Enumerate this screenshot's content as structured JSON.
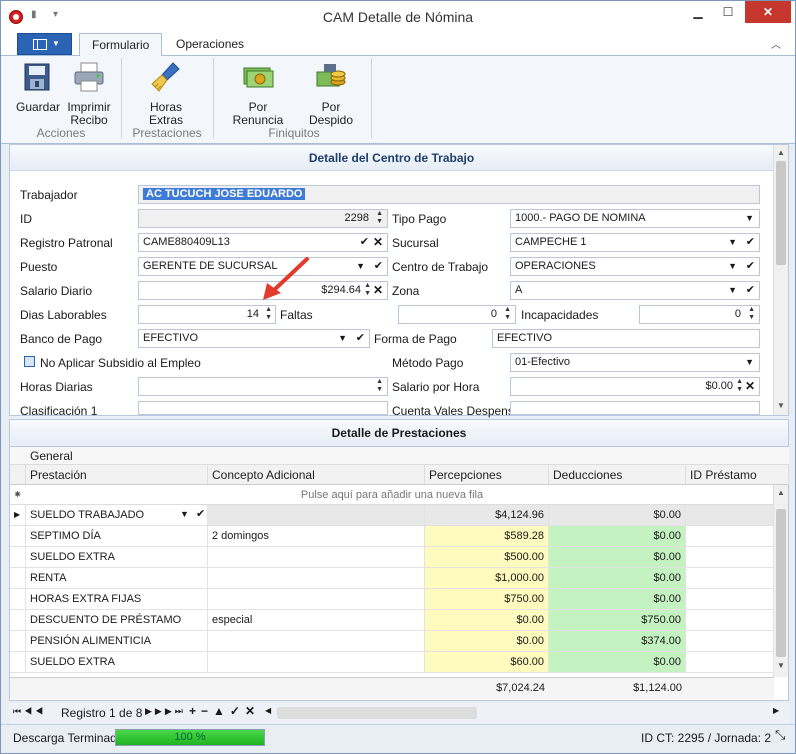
{
  "window": {
    "title": "CAM Detalle de Nómina",
    "minimize": "▁",
    "maximize": "☐",
    "close": "✕"
  },
  "tabs": [
    {
      "label": "Formulario"
    },
    {
      "label": "Operaciones"
    }
  ],
  "ribbon": {
    "buttons": [
      {
        "label": "Guardar"
      },
      {
        "label": "Imprimir\nRecibo"
      },
      {
        "label": "Horas\nExtras"
      },
      {
        "label": "Por Renuncia"
      },
      {
        "label": "Por Despido"
      }
    ],
    "groups": [
      "Acciones",
      "Prestaciones",
      "Finiquitos"
    ]
  },
  "form": {
    "title": "Detalle del Centro de Trabajo",
    "labels": {
      "trabajador": "Trabajador",
      "id": "ID",
      "registro": "Registro Patronal",
      "puesto": "Puesto",
      "salario": "Salario Diario",
      "dias": "Dias Laborables",
      "banco": "Banco de Pago",
      "subsidio": "No Aplicar Subsidio al Empleo",
      "horas": "Horas Diarias",
      "clasif": "Clasificación 1",
      "tipo_pago": "Tipo Pago",
      "sucursal": "Sucursal",
      "centro": "Centro de Trabajo",
      "zona": "Zona",
      "faltas": "Faltas",
      "incap": "Incapacidades",
      "forma": "Forma de Pago",
      "metodo": "Método Pago",
      "salario_hora": "Salario por Hora",
      "vales": "Cuenta Vales Despensa"
    },
    "values": {
      "trabajador": "AC TUCUCH JOSE EDUARDO",
      "id": "2298",
      "registro": "CAME880409L13",
      "puesto": "GERENTE DE SUCURSAL",
      "salario": "$294.64",
      "dias": "14",
      "banco": "EFECTIVO",
      "tipo_pago": "1000.- PAGO DE NOMINA",
      "sucursal": "CAMPECHE 1",
      "centro": "OPERACIONES",
      "zona": "A",
      "faltas": "0",
      "incap": "0",
      "forma": "EFECTIVO",
      "metodo": "01-Efectivo",
      "salario_hora": "$0.00"
    }
  },
  "grid": {
    "title": "Detalle de Prestaciones",
    "group": "General",
    "columns": [
      "Prestación",
      "Concepto Adicional",
      "Percepciones",
      "Deducciones",
      "ID Préstamo"
    ],
    "new_row": "Pulse aquí para añadir una nueva fila",
    "rows": [
      {
        "p": "SUELDO TRABAJADO",
        "c": "",
        "per": "$4,124.96",
        "ded": "$0.00"
      },
      {
        "p": "SEPTIMO DÍA",
        "c": "2 domingos",
        "per": "$589.28",
        "ded": "$0.00"
      },
      {
        "p": "SUELDO EXTRA",
        "c": "",
        "per": "$500.00",
        "ded": "$0.00"
      },
      {
        "p": "RENTA",
        "c": "",
        "per": "$1,000.00",
        "ded": "$0.00"
      },
      {
        "p": "HORAS EXTRA FIJAS",
        "c": "",
        "per": "$750.00",
        "ded": "$0.00"
      },
      {
        "p": "DESCUENTO DE PRÉSTAMO",
        "c": "especial",
        "per": "$0.00",
        "ded": "$750.00"
      },
      {
        "p": "PENSIÓN ALIMENTICIA",
        "c": "",
        "per": "$0.00",
        "ded": "$374.00"
      },
      {
        "p": "SUELDO EXTRA",
        "c": "",
        "per": "$60.00",
        "ded": "$0.00"
      }
    ],
    "total_per": "$7,024.24",
    "total_ded": "$1,124.00",
    "record": "Registro 1 de 8"
  },
  "status": {
    "text": "Descarga Terminada",
    "progress_label": "100 %",
    "progress": 1.0,
    "right": "ID CT: 2295 / Jornada: 2"
  }
}
